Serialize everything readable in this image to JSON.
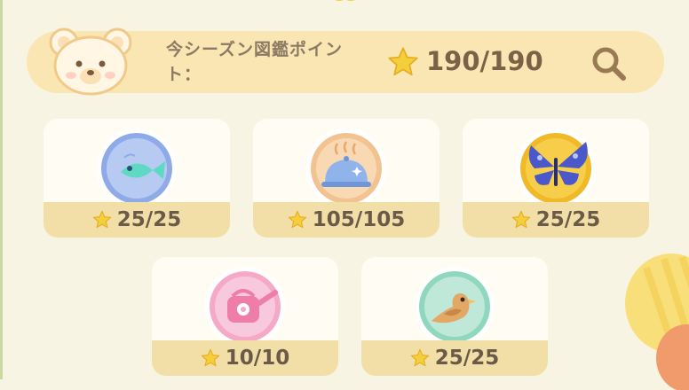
{
  "header": {
    "season_label": "今シーズン図鑑ポイント：",
    "points": "190/190"
  },
  "icons": {
    "bear": "bear-face-icon",
    "star": "star-icon",
    "search": "magnifier-icon"
  },
  "categories": [
    {
      "id": "fish",
      "icon": "fish-icon",
      "count": "25/25"
    },
    {
      "id": "food",
      "icon": "cloche-icon",
      "count": "105/105"
    },
    {
      "id": "insect",
      "icon": "butterfly-icon",
      "count": "25/25"
    },
    {
      "id": "gardening",
      "icon": "watering-can-icon",
      "count": "10/10"
    },
    {
      "id": "bird",
      "icon": "bird-icon",
      "count": "25/25"
    }
  ],
  "colors": {
    "background": "#f7f4e3",
    "header_bar": "#f9e6b3",
    "card_footer": "#f2dfa7",
    "text_dark": "#6b5a48",
    "star": "#f5cf3a"
  }
}
